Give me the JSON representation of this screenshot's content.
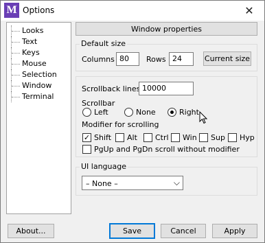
{
  "window": {
    "title": "Options",
    "app_icon_letter": "M",
    "close_glyph": "✕"
  },
  "tree": {
    "items": [
      "Looks",
      "Text",
      "Keys",
      "Mouse",
      "Selection",
      "Window",
      "Terminal"
    ]
  },
  "window_properties_label": "Window properties",
  "default_size": {
    "title": "Default size",
    "columns_label": "Columns",
    "columns_value": "80",
    "rows_label": "Rows",
    "rows_value": "24",
    "current_size_label": "Current size"
  },
  "scroll": {
    "scrollback_label": "Scrollback lines",
    "scrollback_value": "10000",
    "scrollbar_label": "Scrollbar",
    "scrollbar_options": [
      "Left",
      "None",
      "Right"
    ],
    "scrollbar_selected": "Right",
    "modifier_label": "Modifier for scrolling",
    "modifiers": [
      "Shift",
      "Alt",
      "Ctrl",
      "Win",
      "Sup",
      "Hyp"
    ],
    "modifier_checked": "Shift",
    "pgup_label": "PgUp and PgDn scroll without modifier"
  },
  "ui_language": {
    "title": "UI language",
    "value": "– None –"
  },
  "buttons": {
    "about": "About...",
    "save": "Save",
    "cancel": "Cancel",
    "apply": "Apply"
  },
  "colors": {
    "app_icon_bg": "#6a3fb5",
    "default_button_border": "#0078d7"
  }
}
